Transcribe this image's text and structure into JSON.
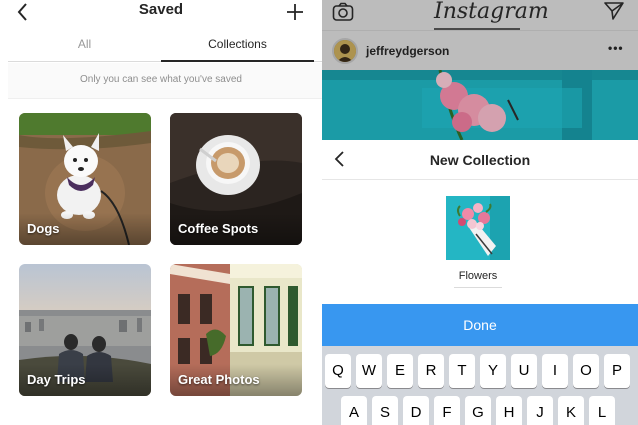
{
  "left": {
    "header": {
      "title": "Saved"
    },
    "tabs": [
      {
        "label": "All"
      },
      {
        "label": "Collections"
      }
    ],
    "notice": "Only you can see what you've saved",
    "collections": [
      {
        "label": "Dogs"
      },
      {
        "label": "Coffee Spots"
      },
      {
        "label": "Day Trips"
      },
      {
        "label": "Great Photos"
      }
    ]
  },
  "right": {
    "app_logo": "Instagram",
    "username": "jeffreydgerson",
    "more": "•••",
    "sheet": {
      "title": "New Collection",
      "collection_name": "Flowers",
      "done_label": "Done"
    },
    "keyboard": {
      "row1": [
        "Q",
        "W",
        "E",
        "R",
        "T",
        "Y",
        "U",
        "I",
        "O",
        "P"
      ],
      "row2": [
        "A",
        "S",
        "D",
        "F",
        "G",
        "H",
        "J",
        "K",
        "L"
      ]
    }
  },
  "colors": {
    "done_button": "#3897f0",
    "dim_overlay": "#d6d6d6",
    "turquoise": "#22b7c4"
  }
}
